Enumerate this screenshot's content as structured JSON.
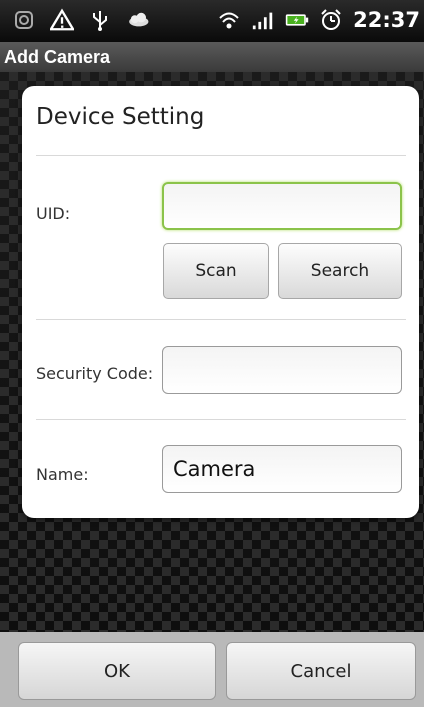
{
  "status_bar": {
    "icons": [
      "sim-icon",
      "warning-icon",
      "usb-icon",
      "weather-icon",
      "wifi-icon",
      "signal-icon",
      "battery-icon",
      "alarm-icon"
    ],
    "time": "22:37"
  },
  "title_bar": {
    "title": "Add Camera"
  },
  "dialog": {
    "title": "Device Setting",
    "uid": {
      "label": "UID:",
      "value": "",
      "placeholder": ""
    },
    "scan_button": "Scan",
    "search_button": "Search",
    "security_code": {
      "label": "Security Code:",
      "value": "",
      "placeholder": ""
    },
    "name": {
      "label": "Name:",
      "value": "Camera",
      "placeholder": ""
    }
  },
  "bottom_bar": {
    "ok_label": "OK",
    "cancel_label": "Cancel"
  },
  "colors": {
    "focus_accent": "#8bc34a",
    "card_bg": "#ffffff",
    "bottom_bar_bg": "#b9b9b9"
  }
}
